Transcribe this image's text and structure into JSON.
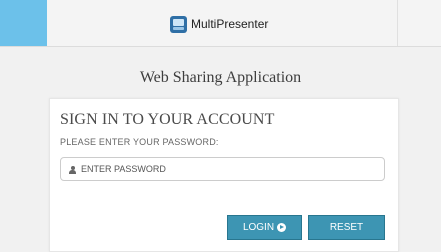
{
  "header": {
    "brand_name": "MultiPresenter",
    "brand_icon": "multipresenter-logo-icon",
    "accent_color": "#6cc1ea"
  },
  "app_title": "Web Sharing Application",
  "login": {
    "title": "SIGN IN TO YOUR ACCOUNT",
    "subtitle": "PLEASE ENTER YOUR PASSWORD:",
    "password_value": "",
    "password_placeholder": "ENTER PASSWORD",
    "password_icon": "user-icon",
    "login_label": "LOGIN",
    "login_icon": "arrow-circle-right-icon",
    "reset_label": "RESET",
    "button_color": "#3d95b3"
  }
}
